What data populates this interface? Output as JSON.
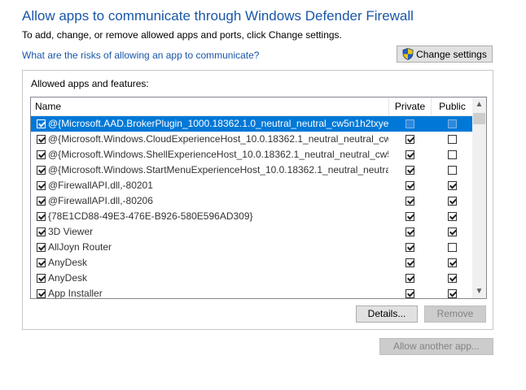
{
  "header": {
    "title": "Allow apps to communicate through Windows Defender Firewall",
    "subtitle": "To add, change, or remove allowed apps and ports, click Change settings.",
    "risk_link": "What are the risks of allowing an app to communicate?",
    "change_settings_label": "Change settings"
  },
  "group": {
    "label": "Allowed apps and features:",
    "columns": {
      "name": "Name",
      "private": "Private",
      "public": "Public"
    },
    "rows": [
      {
        "name": "@{Microsoft.AAD.BrokerPlugin_1000.18362.1.0_neutral_neutral_cw5n1h2txye...",
        "enabled": true,
        "private": false,
        "public": false,
        "selected": true
      },
      {
        "name": "@{Microsoft.Windows.CloudExperienceHost_10.0.18362.1_neutral_neutral_cw...",
        "enabled": true,
        "private": true,
        "public": false
      },
      {
        "name": "@{Microsoft.Windows.ShellExperienceHost_10.0.18362.1_neutral_neutral_cw5...",
        "enabled": true,
        "private": true,
        "public": false
      },
      {
        "name": "@{Microsoft.Windows.StartMenuExperienceHost_10.0.18362.1_neutral_neutra...",
        "enabled": true,
        "private": true,
        "public": false
      },
      {
        "name": "@FirewallAPI.dll,-80201",
        "enabled": true,
        "private": true,
        "public": true
      },
      {
        "name": "@FirewallAPI.dll,-80206",
        "enabled": true,
        "private": true,
        "public": true
      },
      {
        "name": "{78E1CD88-49E3-476E-B926-580E596AD309}",
        "enabled": true,
        "private": true,
        "public": true
      },
      {
        "name": "3D Viewer",
        "enabled": true,
        "private": true,
        "public": true
      },
      {
        "name": "AllJoyn Router",
        "enabled": true,
        "private": true,
        "public": false
      },
      {
        "name": "AnyDesk",
        "enabled": true,
        "private": true,
        "public": true
      },
      {
        "name": "AnyDesk",
        "enabled": true,
        "private": true,
        "public": true
      },
      {
        "name": "App Installer",
        "enabled": true,
        "private": true,
        "public": true
      }
    ],
    "details_label": "Details...",
    "remove_label": "Remove"
  },
  "footer": {
    "allow_another_label": "Allow another app..."
  },
  "colors": {
    "accent": "#0078d7",
    "link": "#1a56a8"
  }
}
